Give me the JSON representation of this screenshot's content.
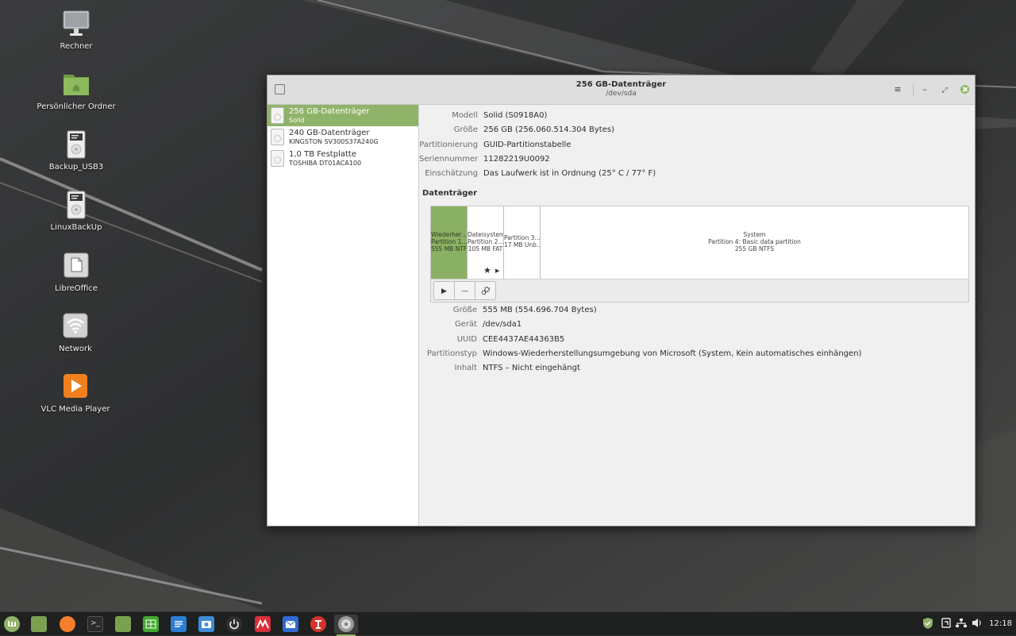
{
  "desktop": {
    "icons": [
      {
        "label": "Rechner",
        "icon": "computer-icon"
      },
      {
        "label": "Persönlicher Ordner",
        "icon": "home-folder-icon"
      },
      {
        "label": "Backup_USB3",
        "icon": "usb-drive-icon"
      },
      {
        "label": "LinuxBackUp",
        "icon": "usb-drive-icon"
      },
      {
        "label": "LibreOffice",
        "icon": "document-icon"
      },
      {
        "label": "Network",
        "icon": "wifi-icon"
      },
      {
        "label": "VLC Media Player",
        "icon": "play-icon"
      }
    ]
  },
  "window": {
    "title": "256 GB-Datenträger",
    "subtitle": "/dev/sda",
    "controls": {
      "menu": "≡",
      "minimize": "–",
      "maximize": "⤢",
      "close": "close"
    }
  },
  "sidebar": {
    "drives": [
      {
        "name": "256 GB-Datenträger",
        "sub": "Solid",
        "selected": true
      },
      {
        "name": "240 GB-Datenträger",
        "sub": "KINGSTON SV300S37A240G",
        "selected": false
      },
      {
        "name": "1,0 TB Festplatte",
        "sub": "TOSHIBA DT01ACA100",
        "selected": false
      }
    ]
  },
  "drive_info": [
    {
      "key": "Modell",
      "value": "Solid (S0918A0)"
    },
    {
      "key": "Größe",
      "value": "256 GB (256.060.514.304 Bytes)"
    },
    {
      "key": "Partitionierung",
      "value": "GUID-Partitionstabelle"
    },
    {
      "key": "Seriennummer",
      "value": "11282219U0092"
    },
    {
      "key": "Einschätzung",
      "value": "Das Laufwerk ist in Ordnung (25° C / 77° F)"
    }
  ],
  "volumes": {
    "heading": "Datenträger",
    "partitions": [
      {
        "line1": "Wiederher…",
        "line2": "Partition 1…",
        "line3": "555 MB NTFS",
        "selected": true
      },
      {
        "line1": "Dateisystem",
        "line2": "Partition 2…",
        "line3": "105 MB FAT",
        "selected": false
      },
      {
        "line1": "Partition 3…",
        "line2": "17 MB Unb…",
        "line3": "",
        "selected": false
      },
      {
        "line1": "System",
        "line2": "Partition 4: Basic data partition",
        "line3": "255 GB NTFS",
        "selected": false
      }
    ],
    "toolbar": {
      "mount": "▶",
      "delete": "—",
      "settings": "settings"
    }
  },
  "partition_info": [
    {
      "key": "Größe",
      "value": "555 MB (554.696.704 Bytes)"
    },
    {
      "key": "Gerät",
      "value": "/dev/sda1"
    },
    {
      "key": "UUID",
      "value": "CEE4437AE44363B5"
    },
    {
      "key": "Partitionstyp",
      "value": "Windows-Wiederherstellungsumgebung von Microsoft (System, Kein automatisches einhängen)"
    },
    {
      "key": "Inhalt",
      "value": "NTFS – Nicht eingehängt"
    }
  ],
  "taskbar": {
    "apps": [
      {
        "name": "mint-menu-icon",
        "color": "#8fb369"
      },
      {
        "name": "show-desktop-icon",
        "color": "#7aa14f"
      },
      {
        "name": "firefox-icon",
        "color": "#f57e2c"
      },
      {
        "name": "terminal-icon",
        "color": "#2b2b2b"
      },
      {
        "name": "files-icon",
        "color": "#7aa14f"
      },
      {
        "name": "spreadsheet-icon",
        "color": "#43a933"
      },
      {
        "name": "writer-icon",
        "color": "#2a7fd4"
      },
      {
        "name": "screenshot-icon",
        "color": "#3f8bd6"
      },
      {
        "name": "power-icon",
        "color": "#2f2f2f"
      },
      {
        "name": "pdf-editor-icon",
        "color": "#d9303a"
      },
      {
        "name": "mail-icon",
        "color": "#2f6bd1"
      },
      {
        "name": "font-manager-icon",
        "color": "#d6322b"
      },
      {
        "name": "disks-icon",
        "color": "#9a9a9a",
        "active": true
      }
    ],
    "clock": "12:18"
  }
}
